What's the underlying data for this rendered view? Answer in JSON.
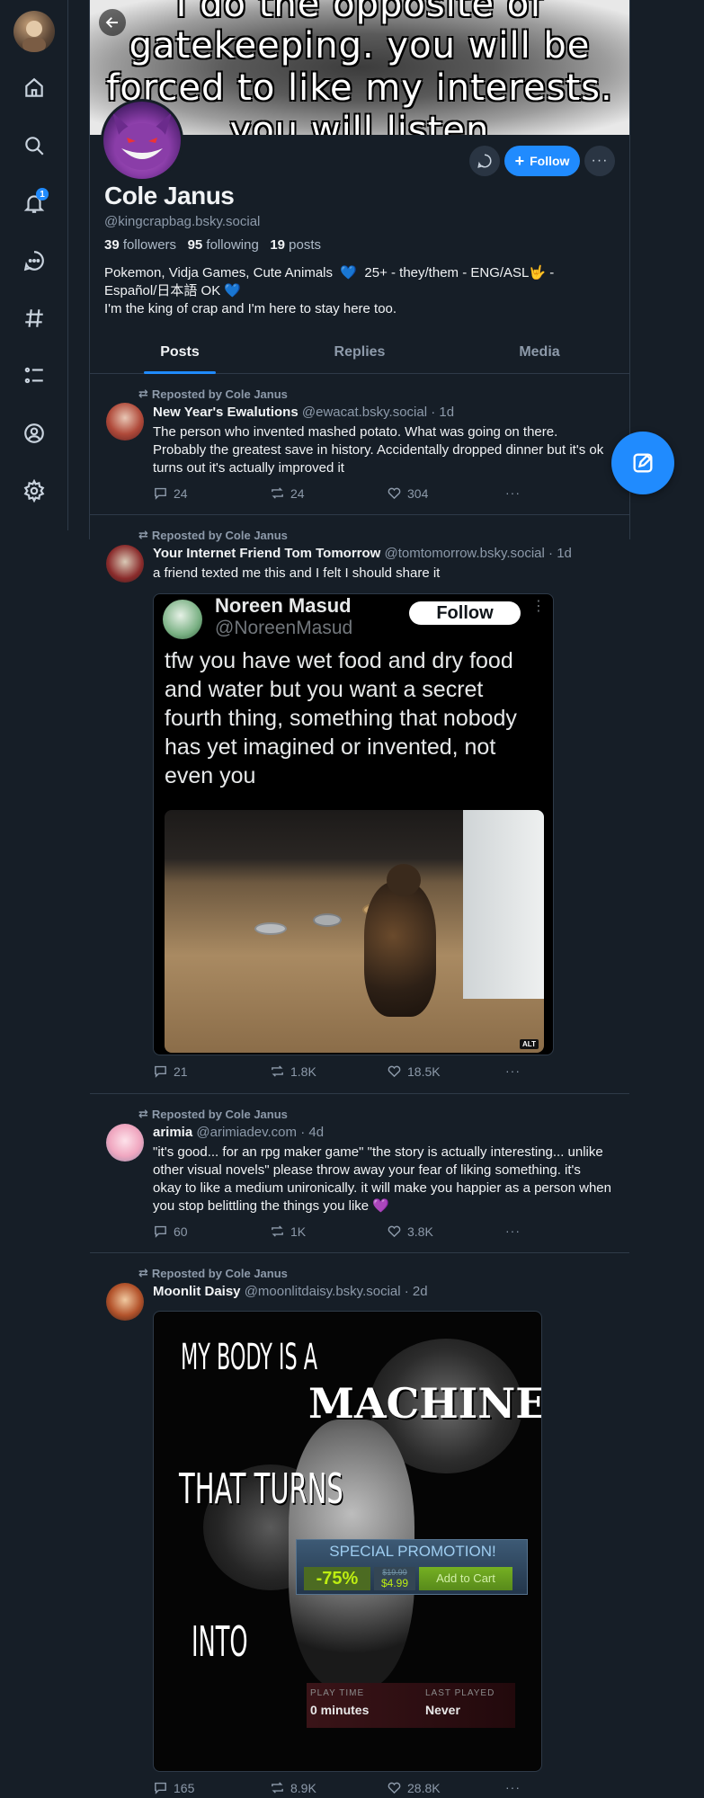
{
  "nav": {
    "notifications_badge": "1",
    "icons": [
      "home-icon",
      "search-icon",
      "bell-icon",
      "chat-icon",
      "hashtag-icon",
      "list-icon",
      "profile-icon",
      "gear-icon"
    ]
  },
  "banner": {
    "lines": [
      "I do the opposite of",
      "gatekeeping. you will be",
      "forced to like my interests.",
      "you will listen"
    ]
  },
  "profile": {
    "display_name": "Cole Janus",
    "handle": "@kingcrapbag.bsky.social",
    "followers_count": "39",
    "followers_label": "followers",
    "following_count": "95",
    "following_label": "following",
    "posts_count": "19",
    "posts_label": "posts",
    "bio_line1": "Pokemon, Vidja Games, Cute Animals",
    "bio_heart": "💙",
    "bio_line1b": "25+ - they/them - ENG/ASL🤟 -",
    "bio_line2": "Español/日本語 OK",
    "bio_line3": "I'm the king of crap and I'm here to stay here too.",
    "follow_label": "Follow"
  },
  "tabs": [
    {
      "label": "Posts"
    },
    {
      "label": "Replies"
    },
    {
      "label": "Media"
    }
  ],
  "posts": [
    {
      "repost_label": "Reposted by Cole Janus",
      "author": "New Year's Ewalutions",
      "handle": "@ewacat.bsky.social",
      "time": "· 1d",
      "text": "The person who invented mashed potato. What was going on there. Probably the greatest save in history. Accidentally dropped dinner but it's ok turns out it's actually improved it",
      "replies": "24",
      "reposts": "24",
      "likes": "304"
    },
    {
      "repost_label": "Reposted by Cole Janus",
      "author": "Your Internet Friend Tom Tomorrow",
      "handle": "@tomtomorrow.bsky.social",
      "time": "· 1d",
      "text": "a friend texted me this and I felt I should share it",
      "embed": {
        "name": "Noreen Masud",
        "handle": "@NoreenMasud",
        "follow": "Follow",
        "text": "tfw you have wet food and dry food and water but you want a secret fourth thing, something that nobody has yet imagined or invented, not even you",
        "alt": "ALT"
      },
      "replies": "21",
      "reposts": "1.8K",
      "likes": "18.5K"
    },
    {
      "repost_label": "Reposted by Cole Janus",
      "author": "arimia",
      "handle": "@arimiadev.com",
      "time": "· 4d",
      "text": "\"it's good... for an rpg maker game\" \"the story is actually interesting... unlike other visual novels\" please throw away your fear of liking something. it's okay to like a medium unironically. it will make you happier as a person when you stop belittling the things you like 💜",
      "replies": "60",
      "reposts": "1K",
      "likes": "3.8K"
    },
    {
      "repost_label": "Reposted by Cole Janus",
      "author": "Moonlit Daisy",
      "handle": "@moonlitdaisy.bsky.social",
      "time": "· 2d",
      "meme": {
        "line1": "MY BODY IS A",
        "line2": "MACHINE",
        "line3": "THAT TURNS",
        "line4": "INTO",
        "promo_title": "SPECIAL PROMOTION!",
        "discount": "-75%",
        "old_price": "$19.99",
        "new_price": "$4.99",
        "cart": "Add to Cart",
        "playtime_label": "PLAY TIME",
        "playtime_value": "0 minutes",
        "lastplayed_label": "LAST PLAYED",
        "lastplayed_value": "Never"
      },
      "replies": "165",
      "reposts": "8.9K",
      "likes": "28.8K"
    }
  ]
}
